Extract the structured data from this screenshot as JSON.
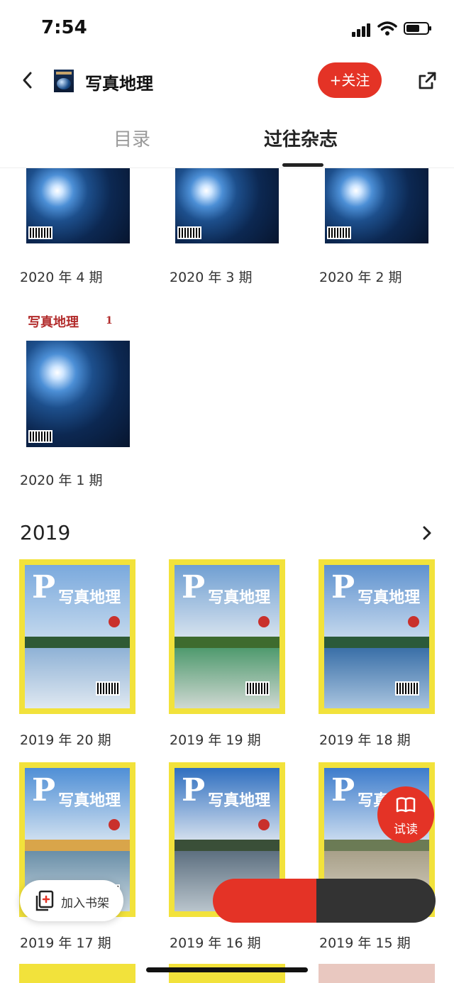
{
  "status": {
    "time": "7:54"
  },
  "header": {
    "title": "写真地理",
    "follow_label": "+关注"
  },
  "tabs": [
    {
      "label": "目录"
    },
    {
      "label": "过往杂志"
    }
  ],
  "issues_2020": [
    {
      "label": "2020 年 4 期"
    },
    {
      "label": "2020 年 3 期"
    },
    {
      "label": "2020 年 2 期"
    },
    {
      "label": "2020 年 1 期",
      "cover_title": "写真地理",
      "cover_number": "1"
    }
  ],
  "section_2019": {
    "year": "2019",
    "issues": [
      {
        "label": "2019 年 20 期",
        "cover_title": "写真地理"
      },
      {
        "label": "2019 年 19 期",
        "cover_title": "写真地理"
      },
      {
        "label": "2019 年 18 期",
        "cover_title": "写真地理"
      },
      {
        "label": "2019 年 17 期",
        "cover_title": "写真地理"
      },
      {
        "label": "2019 年 16 期",
        "cover_title": "写真地理"
      },
      {
        "label": "2019 年 15 期",
        "cover_title": "写真"
      }
    ]
  },
  "actions": {
    "trial_read": "试读",
    "add_shelf": "加入书架"
  },
  "colors": {
    "accent": "#e43326",
    "cover_frame": "#f2e23b",
    "dark": "#333333"
  }
}
